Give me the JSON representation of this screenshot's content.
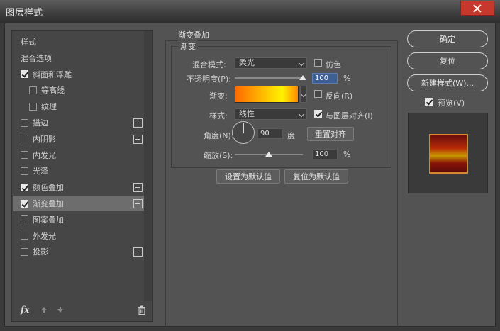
{
  "window": {
    "title": "图层样式"
  },
  "left_panel": {
    "items": [
      {
        "label": "样式",
        "checkbox": false,
        "checked": false,
        "plus": false,
        "indent": 0,
        "selected": false
      },
      {
        "label": "混合选项",
        "checkbox": false,
        "checked": false,
        "plus": false,
        "indent": 0,
        "selected": false
      },
      {
        "label": "斜面和浮雕",
        "checkbox": true,
        "checked": true,
        "plus": false,
        "indent": 0,
        "selected": false
      },
      {
        "label": "等高线",
        "checkbox": true,
        "checked": false,
        "plus": false,
        "indent": 1,
        "selected": false
      },
      {
        "label": "纹理",
        "checkbox": true,
        "checked": false,
        "plus": false,
        "indent": 1,
        "selected": false
      },
      {
        "label": "描边",
        "checkbox": true,
        "checked": false,
        "plus": true,
        "indent": 0,
        "selected": false
      },
      {
        "label": "内阴影",
        "checkbox": true,
        "checked": false,
        "plus": true,
        "indent": 0,
        "selected": false
      },
      {
        "label": "内发光",
        "checkbox": true,
        "checked": false,
        "plus": false,
        "indent": 0,
        "selected": false
      },
      {
        "label": "光泽",
        "checkbox": true,
        "checked": false,
        "plus": false,
        "indent": 0,
        "selected": false
      },
      {
        "label": "颜色叠加",
        "checkbox": true,
        "checked": true,
        "plus": true,
        "indent": 0,
        "selected": false
      },
      {
        "label": "渐变叠加",
        "checkbox": true,
        "checked": true,
        "plus": true,
        "indent": 0,
        "selected": true
      },
      {
        "label": "图案叠加",
        "checkbox": true,
        "checked": false,
        "plus": false,
        "indent": 0,
        "selected": false
      },
      {
        "label": "外发光",
        "checkbox": true,
        "checked": false,
        "plus": false,
        "indent": 0,
        "selected": false
      },
      {
        "label": "投影",
        "checkbox": true,
        "checked": false,
        "plus": true,
        "indent": 0,
        "selected": false
      }
    ],
    "fx_label": "fx"
  },
  "gradient_overlay": {
    "group_title": "渐变叠加",
    "sub_title": "渐变",
    "blend_mode_label": "混合模式:",
    "blend_mode_value": "柔光",
    "dither_label": "仿色",
    "dither_checked": false,
    "opacity_label": "不透明度(P):",
    "opacity_value": "100",
    "opacity_unit": "%",
    "opacity_fraction": 1.0,
    "gradient_label": "渐变:",
    "reverse_label": "反向(R)",
    "reverse_checked": false,
    "style_label": "样式:",
    "style_value": "线性",
    "align_label": "与图层对齐(I)",
    "align_checked": true,
    "angle_label": "角度(N):",
    "angle_value": "90",
    "angle_unit": "度",
    "reset_align_label": "重置对齐",
    "scale_label": "缩放(S):",
    "scale_value": "100",
    "scale_unit": "%",
    "scale_fraction": 0.5,
    "set_default_label": "设置为默认值",
    "reset_default_label": "复位为默认值"
  },
  "right_panel": {
    "ok_label": "确定",
    "reset_label": "复位",
    "new_style_label": "新建样式(W)...",
    "preview_label": "预览(V)",
    "preview_checked": true
  },
  "colors": {
    "close_red": "#c8372c",
    "gradient_start": "#ff6a00",
    "gradient_mid": "#fff200",
    "preview_border": "#d48a2a"
  }
}
